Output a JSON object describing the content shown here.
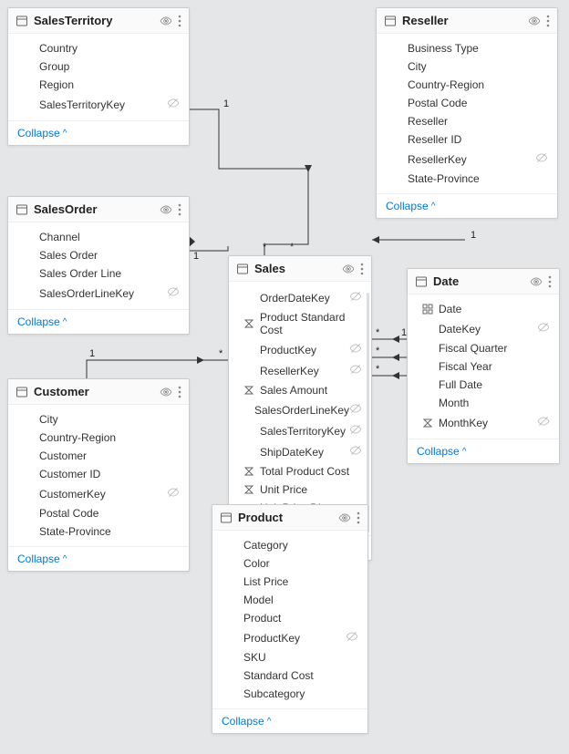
{
  "collapse_label": "Collapse",
  "tables": {
    "salesTerritory": {
      "title": "SalesTerritory",
      "fields": [
        {
          "label": "Country",
          "hidden": false,
          "icon": ""
        },
        {
          "label": "Group",
          "hidden": false,
          "icon": ""
        },
        {
          "label": "Region",
          "hidden": false,
          "icon": ""
        },
        {
          "label": "SalesTerritoryKey",
          "hidden": true,
          "icon": ""
        }
      ]
    },
    "salesOrder": {
      "title": "SalesOrder",
      "fields": [
        {
          "label": "Channel",
          "hidden": false,
          "icon": ""
        },
        {
          "label": "Sales Order",
          "hidden": false,
          "icon": ""
        },
        {
          "label": "Sales Order Line",
          "hidden": false,
          "icon": ""
        },
        {
          "label": "SalesOrderLineKey",
          "hidden": true,
          "icon": ""
        }
      ]
    },
    "customer": {
      "title": "Customer",
      "fields": [
        {
          "label": "City",
          "hidden": false,
          "icon": ""
        },
        {
          "label": "Country-Region",
          "hidden": false,
          "icon": ""
        },
        {
          "label": "Customer",
          "hidden": false,
          "icon": ""
        },
        {
          "label": "Customer ID",
          "hidden": false,
          "icon": ""
        },
        {
          "label": "CustomerKey",
          "hidden": true,
          "icon": ""
        },
        {
          "label": "Postal Code",
          "hidden": false,
          "icon": ""
        },
        {
          "label": "State-Province",
          "hidden": false,
          "icon": ""
        }
      ]
    },
    "reseller": {
      "title": "Reseller",
      "fields": [
        {
          "label": "Business Type",
          "hidden": false,
          "icon": ""
        },
        {
          "label": "City",
          "hidden": false,
          "icon": ""
        },
        {
          "label": "Country-Region",
          "hidden": false,
          "icon": ""
        },
        {
          "label": "Postal Code",
          "hidden": false,
          "icon": ""
        },
        {
          "label": "Reseller",
          "hidden": false,
          "icon": ""
        },
        {
          "label": "Reseller ID",
          "hidden": false,
          "icon": ""
        },
        {
          "label": "ResellerKey",
          "hidden": true,
          "icon": ""
        },
        {
          "label": "State-Province",
          "hidden": false,
          "icon": ""
        }
      ]
    },
    "sales": {
      "title": "Sales",
      "fields": [
        {
          "label": "OrderDateKey",
          "hidden": true,
          "icon": ""
        },
        {
          "label": "Product Standard Cost",
          "hidden": false,
          "icon": "sum"
        },
        {
          "label": "ProductKey",
          "hidden": true,
          "icon": ""
        },
        {
          "label": "ResellerKey",
          "hidden": true,
          "icon": ""
        },
        {
          "label": "Sales Amount",
          "hidden": false,
          "icon": "sum"
        },
        {
          "label": "SalesOrderLineKey",
          "hidden": true,
          "icon": ""
        },
        {
          "label": "SalesTerritoryKey",
          "hidden": true,
          "icon": ""
        },
        {
          "label": "ShipDateKey",
          "hidden": true,
          "icon": ""
        },
        {
          "label": "Total Product Cost",
          "hidden": false,
          "icon": "sum"
        },
        {
          "label": "Unit Price",
          "hidden": false,
          "icon": "sum"
        },
        {
          "label": "Unit Price Discount Pct",
          "hidden": false,
          "icon": "sum"
        }
      ]
    },
    "date": {
      "title": "Date",
      "fields": [
        {
          "label": "Date",
          "hidden": false,
          "icon": "hier"
        },
        {
          "label": "DateKey",
          "hidden": true,
          "icon": ""
        },
        {
          "label": "Fiscal Quarter",
          "hidden": false,
          "icon": ""
        },
        {
          "label": "Fiscal Year",
          "hidden": false,
          "icon": ""
        },
        {
          "label": "Full Date",
          "hidden": false,
          "icon": ""
        },
        {
          "label": "Month",
          "hidden": false,
          "icon": ""
        },
        {
          "label": "MonthKey",
          "hidden": true,
          "icon": "sum"
        }
      ]
    },
    "product": {
      "title": "Product",
      "fields": [
        {
          "label": "Category",
          "hidden": false,
          "icon": ""
        },
        {
          "label": "Color",
          "hidden": false,
          "icon": ""
        },
        {
          "label": "List Price",
          "hidden": false,
          "icon": ""
        },
        {
          "label": "Model",
          "hidden": false,
          "icon": ""
        },
        {
          "label": "Product",
          "hidden": false,
          "icon": ""
        },
        {
          "label": "ProductKey",
          "hidden": true,
          "icon": ""
        },
        {
          "label": "SKU",
          "hidden": false,
          "icon": ""
        },
        {
          "label": "Standard Cost",
          "hidden": false,
          "icon": ""
        },
        {
          "label": "Subcategory",
          "hidden": false,
          "icon": ""
        }
      ]
    }
  },
  "relationships": [
    {
      "from": "salesTerritory",
      "to": "sales",
      "from_card": "1",
      "to_card": "*"
    },
    {
      "from": "salesOrder",
      "to": "sales",
      "from_card": "1",
      "to_card": "*"
    },
    {
      "from": "customer",
      "to": "sales",
      "from_card": "1",
      "to_card": "*"
    },
    {
      "from": "reseller",
      "to": "sales",
      "from_card": "1",
      "to_card": "*"
    },
    {
      "from": "date",
      "to": "sales",
      "from_card": "1",
      "to_card": "*",
      "multi": 3
    },
    {
      "from": "product",
      "to": "sales",
      "from_card": "1",
      "to_card": "*"
    }
  ]
}
